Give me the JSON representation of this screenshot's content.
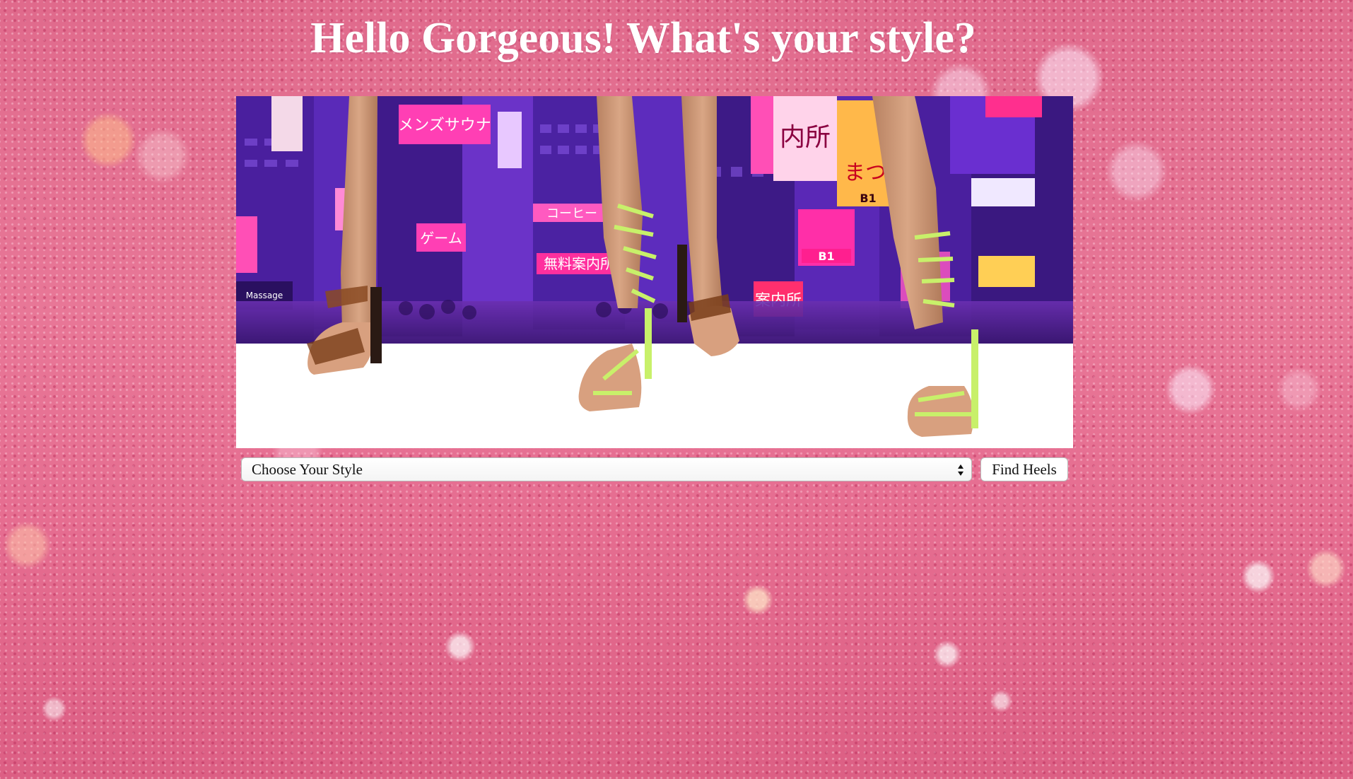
{
  "page": {
    "heading": "Hello Gorgeous! What's your style?",
    "accent_color": "#e87797"
  },
  "hero": {
    "description": "",
    "signs": {
      "sauna": "メンズサウナ",
      "game": "ゲーム",
      "coffee": "コーヒー",
      "info": "無料案内所",
      "anai": "案内所",
      "b1_left": "B1",
      "b1_right": "B1",
      "kanji_top": "内所",
      "matsu": "まつ",
      "massage": "Massage"
    }
  },
  "form": {
    "select_value": "Choose Your Style",
    "button_label": "Find Heels"
  }
}
